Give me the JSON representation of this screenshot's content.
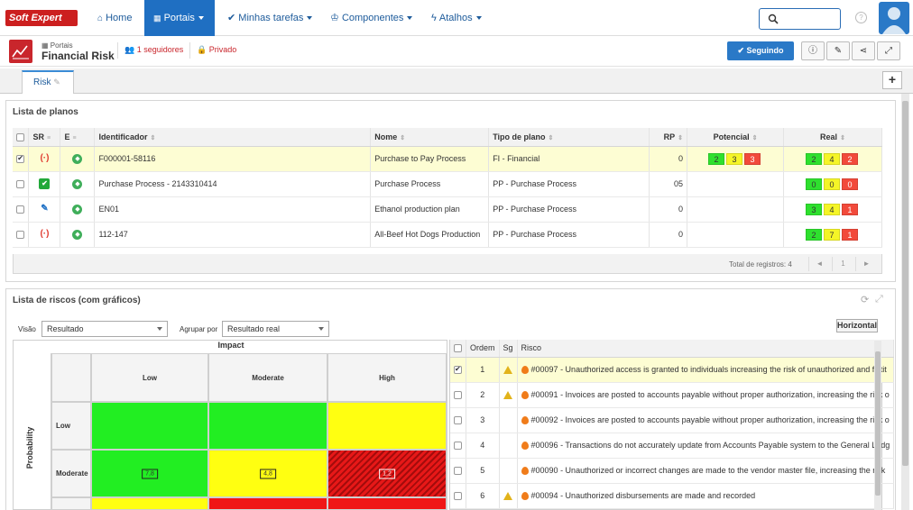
{
  "brand": {
    "logo_text": "Soft Expert"
  },
  "nav": {
    "items": [
      {
        "label": "Home",
        "icon": "home-icon"
      },
      {
        "label": "Portais",
        "icon": "grid-icon",
        "active": true
      },
      {
        "label": "Minhas tarefas",
        "icon": "check-icon"
      },
      {
        "label": "Componentes",
        "icon": "trophy-icon"
      },
      {
        "label": "Atalhos",
        "icon": "bolt-icon"
      }
    ],
    "help_label": "?"
  },
  "header": {
    "portal_label": "Portais",
    "title": "Financial Risk",
    "followers": "1 seguidores",
    "privacy": "Privado",
    "follow_button": "Seguindo"
  },
  "tabs": {
    "active": "Risk"
  },
  "plans": {
    "title": "Lista de planos",
    "columns": [
      "SR",
      "E",
      "Identificador",
      "Nome",
      "Tipo de plano",
      "RP",
      "Potencial",
      "Real"
    ],
    "rows": [
      {
        "selected": true,
        "sr": "red",
        "id": "F000001-58116",
        "name": "Purchase to Pay Process",
        "type": "FI - Financial",
        "rp": "0",
        "potencial": [
          "2",
          "3",
          "3"
        ],
        "real": [
          "2",
          "4",
          "2"
        ]
      },
      {
        "selected": false,
        "sr": "green",
        "id": "Purchase Process - 2143310414",
        "name": "Purchase Process",
        "type": "PP - Purchase Process",
        "rp": "05",
        "potencial": [],
        "real": [
          "0",
          "0",
          "0"
        ]
      },
      {
        "selected": false,
        "sr": "blue",
        "id": "EN01",
        "name": "Ethanol production plan",
        "type": "PP - Purchase Process",
        "rp": "0",
        "potencial": [],
        "real": [
          "3",
          "4",
          "1"
        ]
      },
      {
        "selected": false,
        "sr": "red",
        "id": "112-147",
        "name": "All-Beef Hot Dogs Production",
        "type": "PP - Purchase Process",
        "rp": "0",
        "potencial": [],
        "real": [
          "2",
          "7",
          "1"
        ]
      }
    ],
    "total": "Total de registros: 4",
    "page": "1"
  },
  "risks": {
    "title": "Lista de riscos (com gráficos)",
    "visao_label": "Visão",
    "visao_value": "Resultado",
    "agrupar_label": "Agrupar por",
    "agrupar_value": "Resultado real",
    "horizontal_button": "Horizontal",
    "matrix": {
      "impact_label": "Impact",
      "probability_label": "Probability",
      "columns": [
        "Low",
        "Moderate",
        "High"
      ],
      "rows": [
        "Low",
        "Moderate"
      ],
      "values": {
        "moderate_low": "7,8",
        "moderate_moderate": "4,8",
        "moderate_high": "1,2"
      },
      "colors": {
        "green": "#22ee22",
        "yellow": "#ffff11",
        "red": "#e71818"
      }
    },
    "list_columns": [
      "Ordem",
      "Sg",
      "Risco"
    ],
    "list": [
      {
        "order": "1",
        "warn": true,
        "selected": true,
        "text": "#00097 - Unauthorized access is granted to individuals increasing the risk of unauthorized and fictit"
      },
      {
        "order": "2",
        "warn": true,
        "selected": false,
        "text": "#00091 - Invoices are posted to accounts payable without proper authorization, increasing the risk o"
      },
      {
        "order": "3",
        "warn": false,
        "selected": false,
        "text": "#00092 - Invoices are posted to accounts payable without proper authorization, increasing the risk o"
      },
      {
        "order": "4",
        "warn": false,
        "selected": false,
        "text": "#00096 - Transactions do not accurately update from Accounts Payable system to the General Ledg"
      },
      {
        "order": "5",
        "warn": false,
        "selected": false,
        "text": "#00090 - Unauthorized or incorrect changes are made to the vendor master file, increasing the risk"
      },
      {
        "order": "6",
        "warn": true,
        "selected": false,
        "text": "#00094 - Unauthorized disbursements are made and recorded"
      }
    ]
  }
}
